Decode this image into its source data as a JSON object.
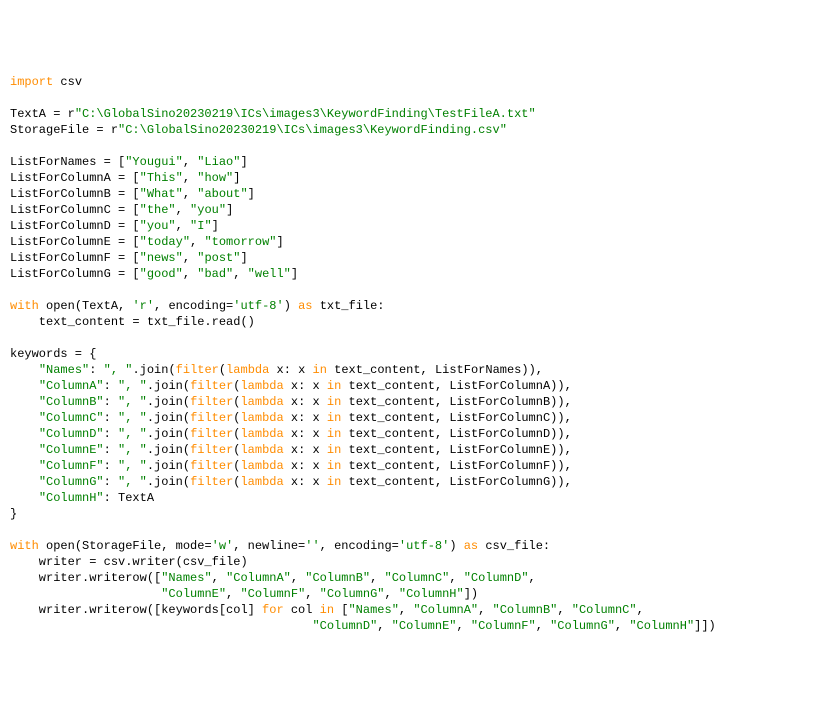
{
  "l1": {
    "a": "import",
    "b": " csv"
  },
  "l2": "",
  "l3": {
    "a": "TextA = r",
    "b": "\"C:\\GlobalSino20230219\\ICs\\images3\\KeywordFinding\\TestFileA.txt\""
  },
  "l4": {
    "a": "StorageFile = r",
    "b": "\"C:\\GlobalSino20230219\\ICs\\images3\\KeywordFinding.csv\""
  },
  "l5": "",
  "l6": {
    "a": "ListForNames = [",
    "b": "\"Yougui\"",
    "c": ", ",
    "d": "\"Liao\"",
    "e": "]"
  },
  "l7": {
    "a": "ListForColumnA = [",
    "b": "\"This\"",
    "c": ", ",
    "d": "\"how\"",
    "e": "]"
  },
  "l8": {
    "a": "ListForColumnB = [",
    "b": "\"What\"",
    "c": ", ",
    "d": "\"about\"",
    "e": "]"
  },
  "l9": {
    "a": "ListForColumnC = [",
    "b": "\"the\"",
    "c": ", ",
    "d": "\"you\"",
    "e": "]"
  },
  "l10": {
    "a": "ListForColumnD = [",
    "b": "\"you\"",
    "c": ", ",
    "d": "\"I\"",
    "e": "]"
  },
  "l11": {
    "a": "ListForColumnE = [",
    "b": "\"today\"",
    "c": ", ",
    "d": "\"tomorrow\"",
    "e": "]"
  },
  "l12": {
    "a": "ListForColumnF = [",
    "b": "\"news\"",
    "c": ", ",
    "d": "\"post\"",
    "e": "]"
  },
  "l13": {
    "a": "ListForColumnG = [",
    "b": "\"good\"",
    "c": ", ",
    "d": "\"bad\"",
    "e": ", ",
    "f": "\"well\"",
    "g": "]"
  },
  "l14": "",
  "l15": {
    "a": "with",
    "b": " open(TextA, ",
    "c": "'r'",
    "d": ", encoding=",
    "e": "'utf-8'",
    "f": ") ",
    "g": "as",
    "h": " txt_file:"
  },
  "l16": {
    "a": "    text_content = txt_file.read()"
  },
  "l17": "",
  "l18": {
    "a": "keywords = {"
  },
  "l19": {
    "a": "    ",
    "b": "\"Names\"",
    "c": ": ",
    "d": "\", \"",
    "e": ".join(",
    "f": "filter",
    "g": "(",
    "h": "lambda",
    "i": " x: x ",
    "j": "in",
    "k": " text_content, ListForNames)),"
  },
  "l20": {
    "a": "    ",
    "b": "\"ColumnA\"",
    "c": ": ",
    "d": "\", \"",
    "e": ".join(",
    "f": "filter",
    "g": "(",
    "h": "lambda",
    "i": " x: x ",
    "j": "in",
    "k": " text_content, ListForColumnA)),"
  },
  "l21": {
    "a": "    ",
    "b": "\"ColumnB\"",
    "c": ": ",
    "d": "\", \"",
    "e": ".join(",
    "f": "filter",
    "g": "(",
    "h": "lambda",
    "i": " x: x ",
    "j": "in",
    "k": " text_content, ListForColumnB)),"
  },
  "l22": {
    "a": "    ",
    "b": "\"ColumnC\"",
    "c": ": ",
    "d": "\", \"",
    "e": ".join(",
    "f": "filter",
    "g": "(",
    "h": "lambda",
    "i": " x: x ",
    "j": "in",
    "k": " text_content, ListForColumnC)),"
  },
  "l23": {
    "a": "    ",
    "b": "\"ColumnD\"",
    "c": ": ",
    "d": "\", \"",
    "e": ".join(",
    "f": "filter",
    "g": "(",
    "h": "lambda",
    "i": " x: x ",
    "j": "in",
    "k": " text_content, ListForColumnD)),"
  },
  "l24": {
    "a": "    ",
    "b": "\"ColumnE\"",
    "c": ": ",
    "d": "\", \"",
    "e": ".join(",
    "f": "filter",
    "g": "(",
    "h": "lambda",
    "i": " x: x ",
    "j": "in",
    "k": " text_content, ListForColumnE)),"
  },
  "l25": {
    "a": "    ",
    "b": "\"ColumnF\"",
    "c": ": ",
    "d": "\", \"",
    "e": ".join(",
    "f": "filter",
    "g": "(",
    "h": "lambda",
    "i": " x: x ",
    "j": "in",
    "k": " text_content, ListForColumnF)),"
  },
  "l26": {
    "a": "    ",
    "b": "\"ColumnG\"",
    "c": ": ",
    "d": "\", \"",
    "e": ".join(",
    "f": "filter",
    "g": "(",
    "h": "lambda",
    "i": " x: x ",
    "j": "in",
    "k": " text_content, ListForColumnG)),"
  },
  "l27": {
    "a": "    ",
    "b": "\"ColumnH\"",
    "c": ": TextA"
  },
  "l28": {
    "a": "}"
  },
  "l29": "",
  "l30": {
    "a": "with",
    "b": " open(StorageFile, mode=",
    "c": "'w'",
    "d": ", newline=",
    "e": "''",
    "f": ", encoding=",
    "g": "'utf-8'",
    "h": ") ",
    "i": "as",
    "j": " csv_file:"
  },
  "l31": {
    "a": "    writer = csv.writer(csv_file)"
  },
  "l32": {
    "a": "    writer.writerow([",
    "b": "\"Names\"",
    "c": ", ",
    "d": "\"ColumnA\"",
    "e": ", ",
    "f": "\"ColumnB\"",
    "g": ", ",
    "h": "\"ColumnC\"",
    "i": ", ",
    "j": "\"ColumnD\"",
    "k": ","
  },
  "l33": {
    "a": "                     ",
    "b": "\"ColumnE\"",
    "c": ", ",
    "d": "\"ColumnF\"",
    "e": ", ",
    "f": "\"ColumnG\"",
    "g": ", ",
    "h": "\"ColumnH\"",
    "i": "])"
  },
  "l34": {
    "a": "    writer.writerow([keywords[col] ",
    "b": "for",
    "c": " col ",
    "d": "in",
    "e": " [",
    "f": "\"Names\"",
    "g": ", ",
    "h": "\"ColumnA\"",
    "i": ", ",
    "j": "\"ColumnB\"",
    "k": ", ",
    "l": "\"ColumnC\"",
    "m": ","
  },
  "l35": {
    "a": "                                          ",
    "b": "\"ColumnD\"",
    "c": ", ",
    "d": "\"ColumnE\"",
    "e": ", ",
    "f": "\"ColumnF\"",
    "g": ", ",
    "h": "\"ColumnG\"",
    "i": ", ",
    "j": "\"ColumnH\"",
    "k": "]])"
  }
}
